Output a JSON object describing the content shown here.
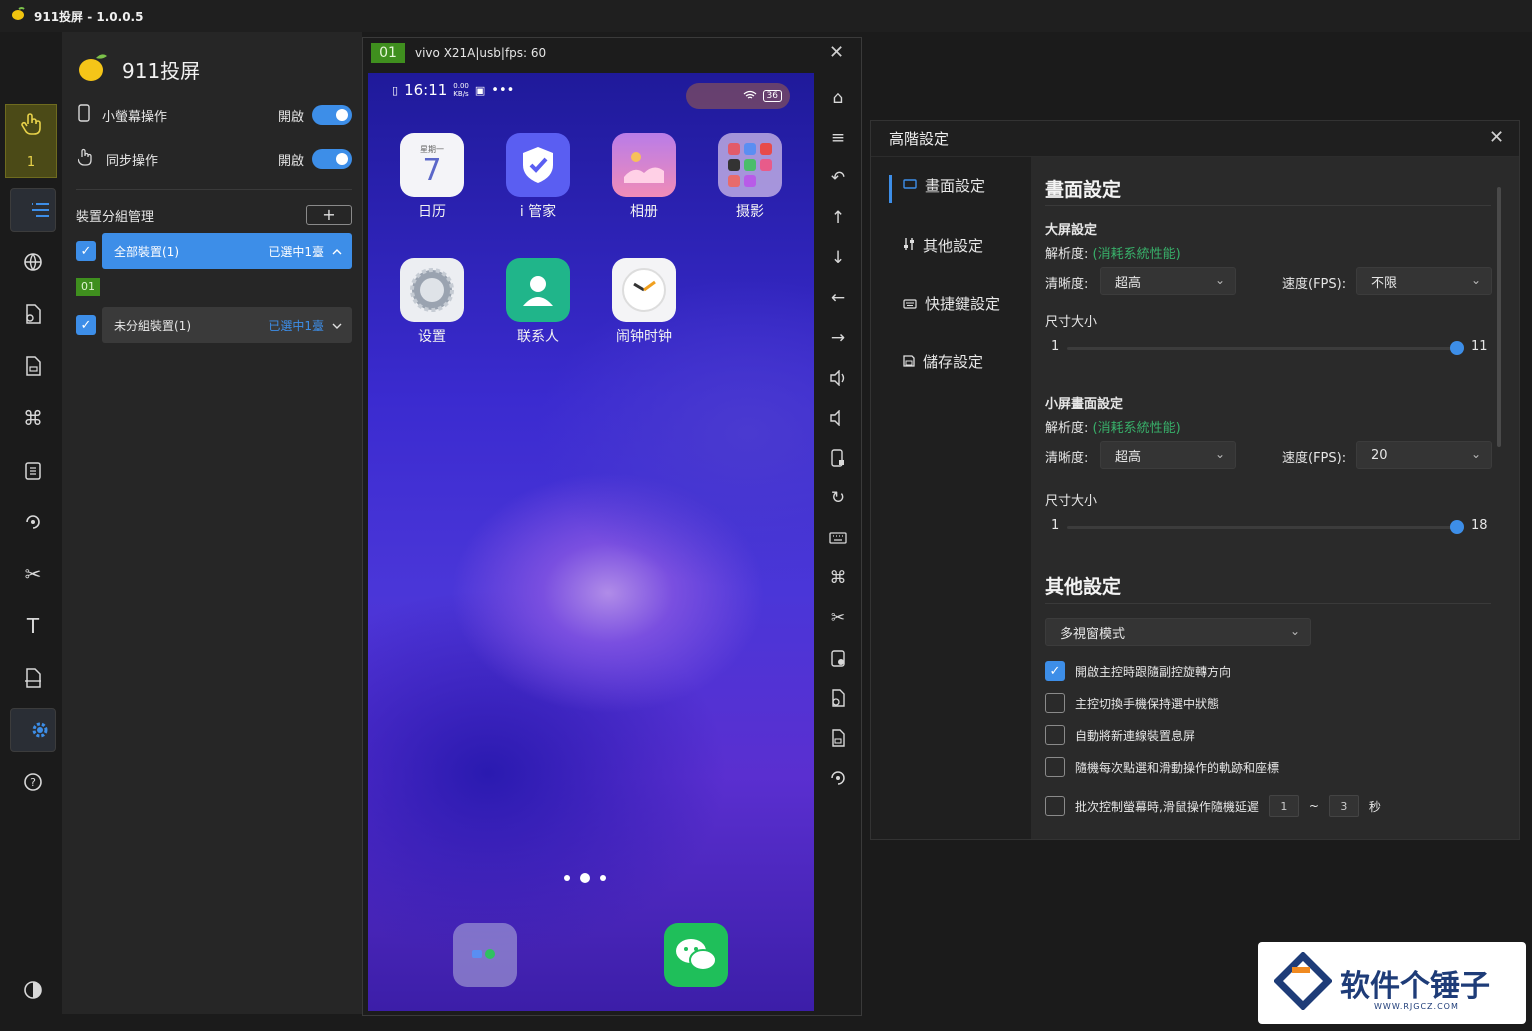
{
  "window": {
    "title": "911投屏 - 1.0.0.5"
  },
  "rail": {
    "active_count": "1"
  },
  "panel": {
    "app_name": "911投屏",
    "small_screen": {
      "label": "小螢幕操作",
      "state": "開啟"
    },
    "sync": {
      "label": "同步操作",
      "state": "開啟"
    },
    "group_title": "裝置分組管理",
    "add_label": "+",
    "groups": [
      {
        "name": "全部裝置(1)",
        "selected": "已選中1臺"
      },
      {
        "name": "未分組裝置(1)",
        "selected": "已選中1臺"
      }
    ],
    "device_tag": "01"
  },
  "phone": {
    "index": "01",
    "info": "vivo X21A|usb|fps: 60",
    "time": "16:11",
    "net_speed": "0.00",
    "net_unit": "KB/s",
    "battery": "36",
    "calendar_day": "星期一",
    "calendar_date": "7",
    "apps": [
      "日历",
      "i 管家",
      "相册",
      "摄影",
      "设置",
      "联系人",
      "闹钟时钟"
    ]
  },
  "settings": {
    "title": "高階設定",
    "nav": [
      "畫面設定",
      "其他設定",
      "快捷鍵設定",
      "儲存設定"
    ],
    "screen_heading": "畫面設定",
    "big": {
      "title": "大屏設定",
      "res_label": "解析度:",
      "res_note": "(消耗系統性能)",
      "clarity_label": "清晰度:",
      "clarity_value": "超高",
      "fps_label": "速度(FPS):",
      "fps_value": "不限",
      "size_label": "尺寸大小",
      "size_min": "1",
      "size_value": "11"
    },
    "small": {
      "title": "小屏畫面設定",
      "res_label": "解析度:",
      "res_note": "(消耗系統性能)",
      "clarity_label": "清晰度:",
      "clarity_value": "超高",
      "fps_label": "速度(FPS):",
      "fps_value": "20",
      "size_label": "尺寸大小",
      "size_min": "1",
      "size_value": "18"
    },
    "other_heading": "其他設定",
    "mode_value": "多視窗模式",
    "checks": [
      {
        "label": "開啟主控時跟隨副控旋轉方向",
        "checked": true
      },
      {
        "label": "主控切換手機保持選中狀態",
        "checked": false
      },
      {
        "label": "自動將新連線裝置息屏",
        "checked": false
      },
      {
        "label": "隨機每次點選和滑動操作的軌跡和座標",
        "checked": false
      },
      {
        "label": "批次控制螢幕時,滑鼠操作隨機延遲",
        "checked": false
      }
    ],
    "delay_min": "1",
    "delay_sep": "~",
    "delay_max": "3",
    "delay_unit": "秒"
  },
  "watermark": {
    "text": "软件个锤子",
    "sub": "WWW.RJGCZ.COM"
  },
  "colors": {
    "accent": "#3d8ee8",
    "device_green": "#3f8f1e",
    "note_green": "#38b06a"
  }
}
